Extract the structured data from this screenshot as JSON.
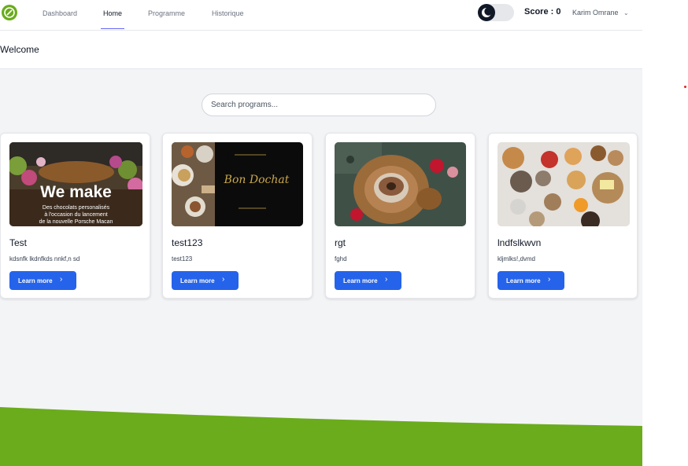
{
  "nav": {
    "links": [
      "Dashboard",
      "Home",
      "Programme",
      "Historique"
    ],
    "active": "Home",
    "score": "Score : 0",
    "user": "Karim Omrane"
  },
  "page": {
    "title": "Welcome"
  },
  "search": {
    "placeholder": "Search programs..."
  },
  "cards": [
    {
      "title": "Test",
      "description": "kdsnfk lkdnfkds nnkf,n sd",
      "button": "Learn more",
      "image_text": [
        "We make",
        "Des chocolats personalisés",
        "à l'occasion du lancement",
        "de la nouvelle Porsche Macan"
      ]
    },
    {
      "title": "test123",
      "description": "test123",
      "button": "Learn more"
    },
    {
      "title": "rgt",
      "description": "fghd",
      "button": "Learn more"
    },
    {
      "title": "lndfslkwvn",
      "description": "kljmlks!,dvmd",
      "button": "Learn more"
    }
  ],
  "colors": {
    "brand_green": "#6aac1c",
    "primary_blue": "#2563eb",
    "background": "#f3f4f6"
  }
}
